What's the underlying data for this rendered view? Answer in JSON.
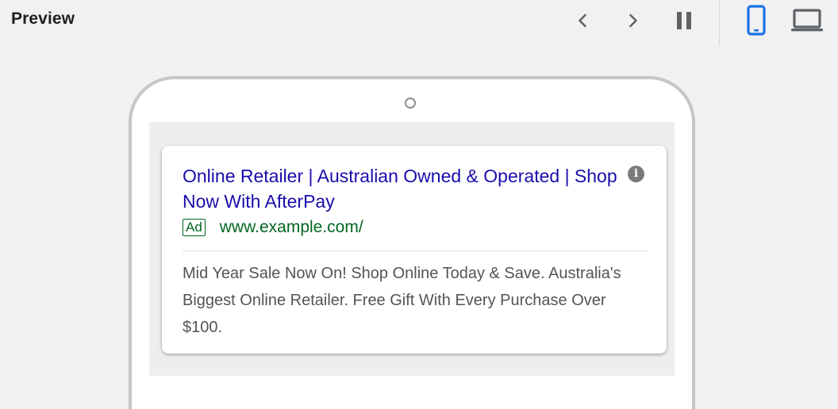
{
  "header": {
    "title": "Preview"
  },
  "toolbar": {
    "prev_icon": "chevron-left-icon",
    "next_icon": "chevron-right-icon",
    "pause_icon": "pause-icon",
    "mobile_icon": "smartphone-icon",
    "desktop_icon": "laptop-icon",
    "active_color": "#1a73e8",
    "icon_color": "#5f6368"
  },
  "ad": {
    "headline": "Online Retailer | Australian Owned & Operated | Shop Now With AfterPay",
    "badge": "Ad",
    "url": "www.example.com/",
    "description": "Mid Year Sale Now On! Shop Online Today & Save. Australia's Biggest Online Retailer. Free Gift With Every Purchase Over $100.",
    "info_icon": "info-icon",
    "info_glyph": "i",
    "headline_color": "#1a0dab",
    "url_color": "#006621",
    "description_color": "#545454"
  }
}
